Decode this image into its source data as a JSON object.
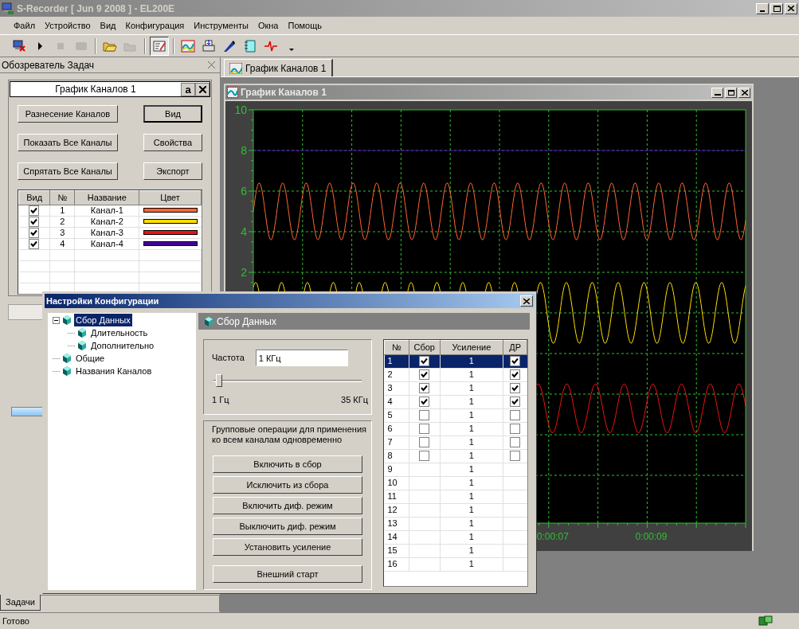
{
  "window": {
    "title": "S-Recorder [ Jun  9 2008 ] - EL200E"
  },
  "menu": [
    "Файл",
    "Устройство",
    "Вид",
    "Конфигурация",
    "Инструменты",
    "Окна",
    "Помощь"
  ],
  "toolbar": [
    {
      "kind": "computer",
      "pressed": false,
      "disabled": false
    },
    {
      "kind": "play",
      "pressed": false,
      "disabled": false
    },
    {
      "kind": "stop",
      "pressed": false,
      "disabled": true
    },
    {
      "kind": "device",
      "pressed": false,
      "disabled": true
    },
    {
      "kind": "separator"
    },
    {
      "kind": "open",
      "pressed": false,
      "disabled": false
    },
    {
      "kind": "save",
      "pressed": false,
      "disabled": true
    },
    {
      "kind": "separator"
    },
    {
      "kind": "settings",
      "pressed": true,
      "disabled": false
    },
    {
      "kind": "separator"
    },
    {
      "kind": "chart",
      "pressed": false,
      "disabled": false
    },
    {
      "kind": "printer",
      "pressed": false,
      "disabled": false
    },
    {
      "kind": "pen",
      "pressed": false,
      "disabled": false
    },
    {
      "kind": "notebook",
      "pressed": false,
      "disabled": false
    },
    {
      "kind": "pulse",
      "pressed": false,
      "disabled": false
    },
    {
      "kind": "dropdown",
      "pressed": false,
      "disabled": false
    }
  ],
  "task_panel": {
    "title": "Обозреватель Задач",
    "card_title": "График Каналов 1",
    "card_button": "a",
    "buttons": [
      {
        "label": "Разнесение Каналов",
        "default": false
      },
      {
        "label": "Вид",
        "default": true
      },
      {
        "label": "Показать Все Каналы",
        "default": false
      },
      {
        "label": "Свойства",
        "default": false
      },
      {
        "label": "Спрятать Все Каналы",
        "default": false
      },
      {
        "label": "Экспорт",
        "default": false
      }
    ],
    "columns": [
      "Вид",
      "№",
      "Название",
      "Цвет"
    ],
    "channels": [
      {
        "visible": true,
        "number": "1",
        "name": "Канал-1",
        "color": "#ff6633"
      },
      {
        "visible": true,
        "number": "2",
        "name": "Канал-2",
        "color": "#ffdd00"
      },
      {
        "visible": true,
        "number": "3",
        "name": "Канал-3",
        "color": "#ee1111"
      },
      {
        "visible": true,
        "number": "4",
        "name": "Канал-4",
        "color": "#440099"
      }
    ],
    "bottom_tab": "Задачи"
  },
  "document_tab": "График Каналов 1",
  "chart_window": {
    "title": "График Каналов 1",
    "y_labels": [
      "10",
      "8",
      "6",
      "4",
      "2"
    ],
    "x_labels": [
      "0:00:07",
      "0:00:09"
    ]
  },
  "dialog": {
    "title": "Настройки Конфигурации",
    "tree": [
      {
        "label": "Сбор Данных",
        "selected": true,
        "expanded": true,
        "children": [
          {
            "label": "Длительность",
            "selected": false
          },
          {
            "label": "Дополнительно",
            "selected": false
          }
        ]
      },
      {
        "label": "Общие",
        "selected": false
      },
      {
        "label": "Названия Каналов",
        "selected": false
      }
    ],
    "section_title": "Сбор Данных",
    "frequency_label": "Частота",
    "frequency_value": "1 КГц",
    "slider": {
      "level": 0.04
    },
    "min_label": "1 Гц",
    "max_label": "35 КГц",
    "group_note": "Групповые операции для применения ко всем каналам одновременно",
    "buttons": [
      "Включить в сбор",
      "Исключить из сбора",
      "Включить диф. режим",
      "Выключить диф. режим",
      "Установить усиление",
      "Внешний старт"
    ],
    "columns": [
      "№",
      "Сбор",
      "Усиление",
      "ДР"
    ],
    "rows": [
      {
        "number": "1",
        "collect": true,
        "gain": "1",
        "diff": true,
        "selected": true
      },
      {
        "number": "2",
        "collect": true,
        "gain": "1",
        "diff": true,
        "selected": false
      },
      {
        "number": "3",
        "collect": true,
        "gain": "1",
        "diff": true,
        "selected": false
      },
      {
        "number": "4",
        "collect": true,
        "gain": "1",
        "diff": true,
        "selected": false
      },
      {
        "number": "5",
        "collect": false,
        "gain": "1",
        "diff": false,
        "selected": false
      },
      {
        "number": "6",
        "collect": false,
        "gain": "1",
        "diff": false,
        "selected": false
      },
      {
        "number": "7",
        "collect": false,
        "gain": "1",
        "diff": false,
        "selected": false
      },
      {
        "number": "8",
        "collect": false,
        "gain": "1",
        "diff": false,
        "selected": false
      },
      {
        "number": "9",
        "gain": "1",
        "selected": false
      },
      {
        "number": "10",
        "gain": "1",
        "selected": false
      },
      {
        "number": "11",
        "gain": "1",
        "selected": false
      },
      {
        "number": "12",
        "gain": "1",
        "selected": false
      },
      {
        "number": "13",
        "gain": "1",
        "selected": false
      },
      {
        "number": "14",
        "gain": "1",
        "selected": false
      },
      {
        "number": "15",
        "gain": "1",
        "selected": false
      },
      {
        "number": "16",
        "gain": "1",
        "selected": false
      }
    ]
  },
  "status_bar": {
    "text": "Готово"
  }
}
